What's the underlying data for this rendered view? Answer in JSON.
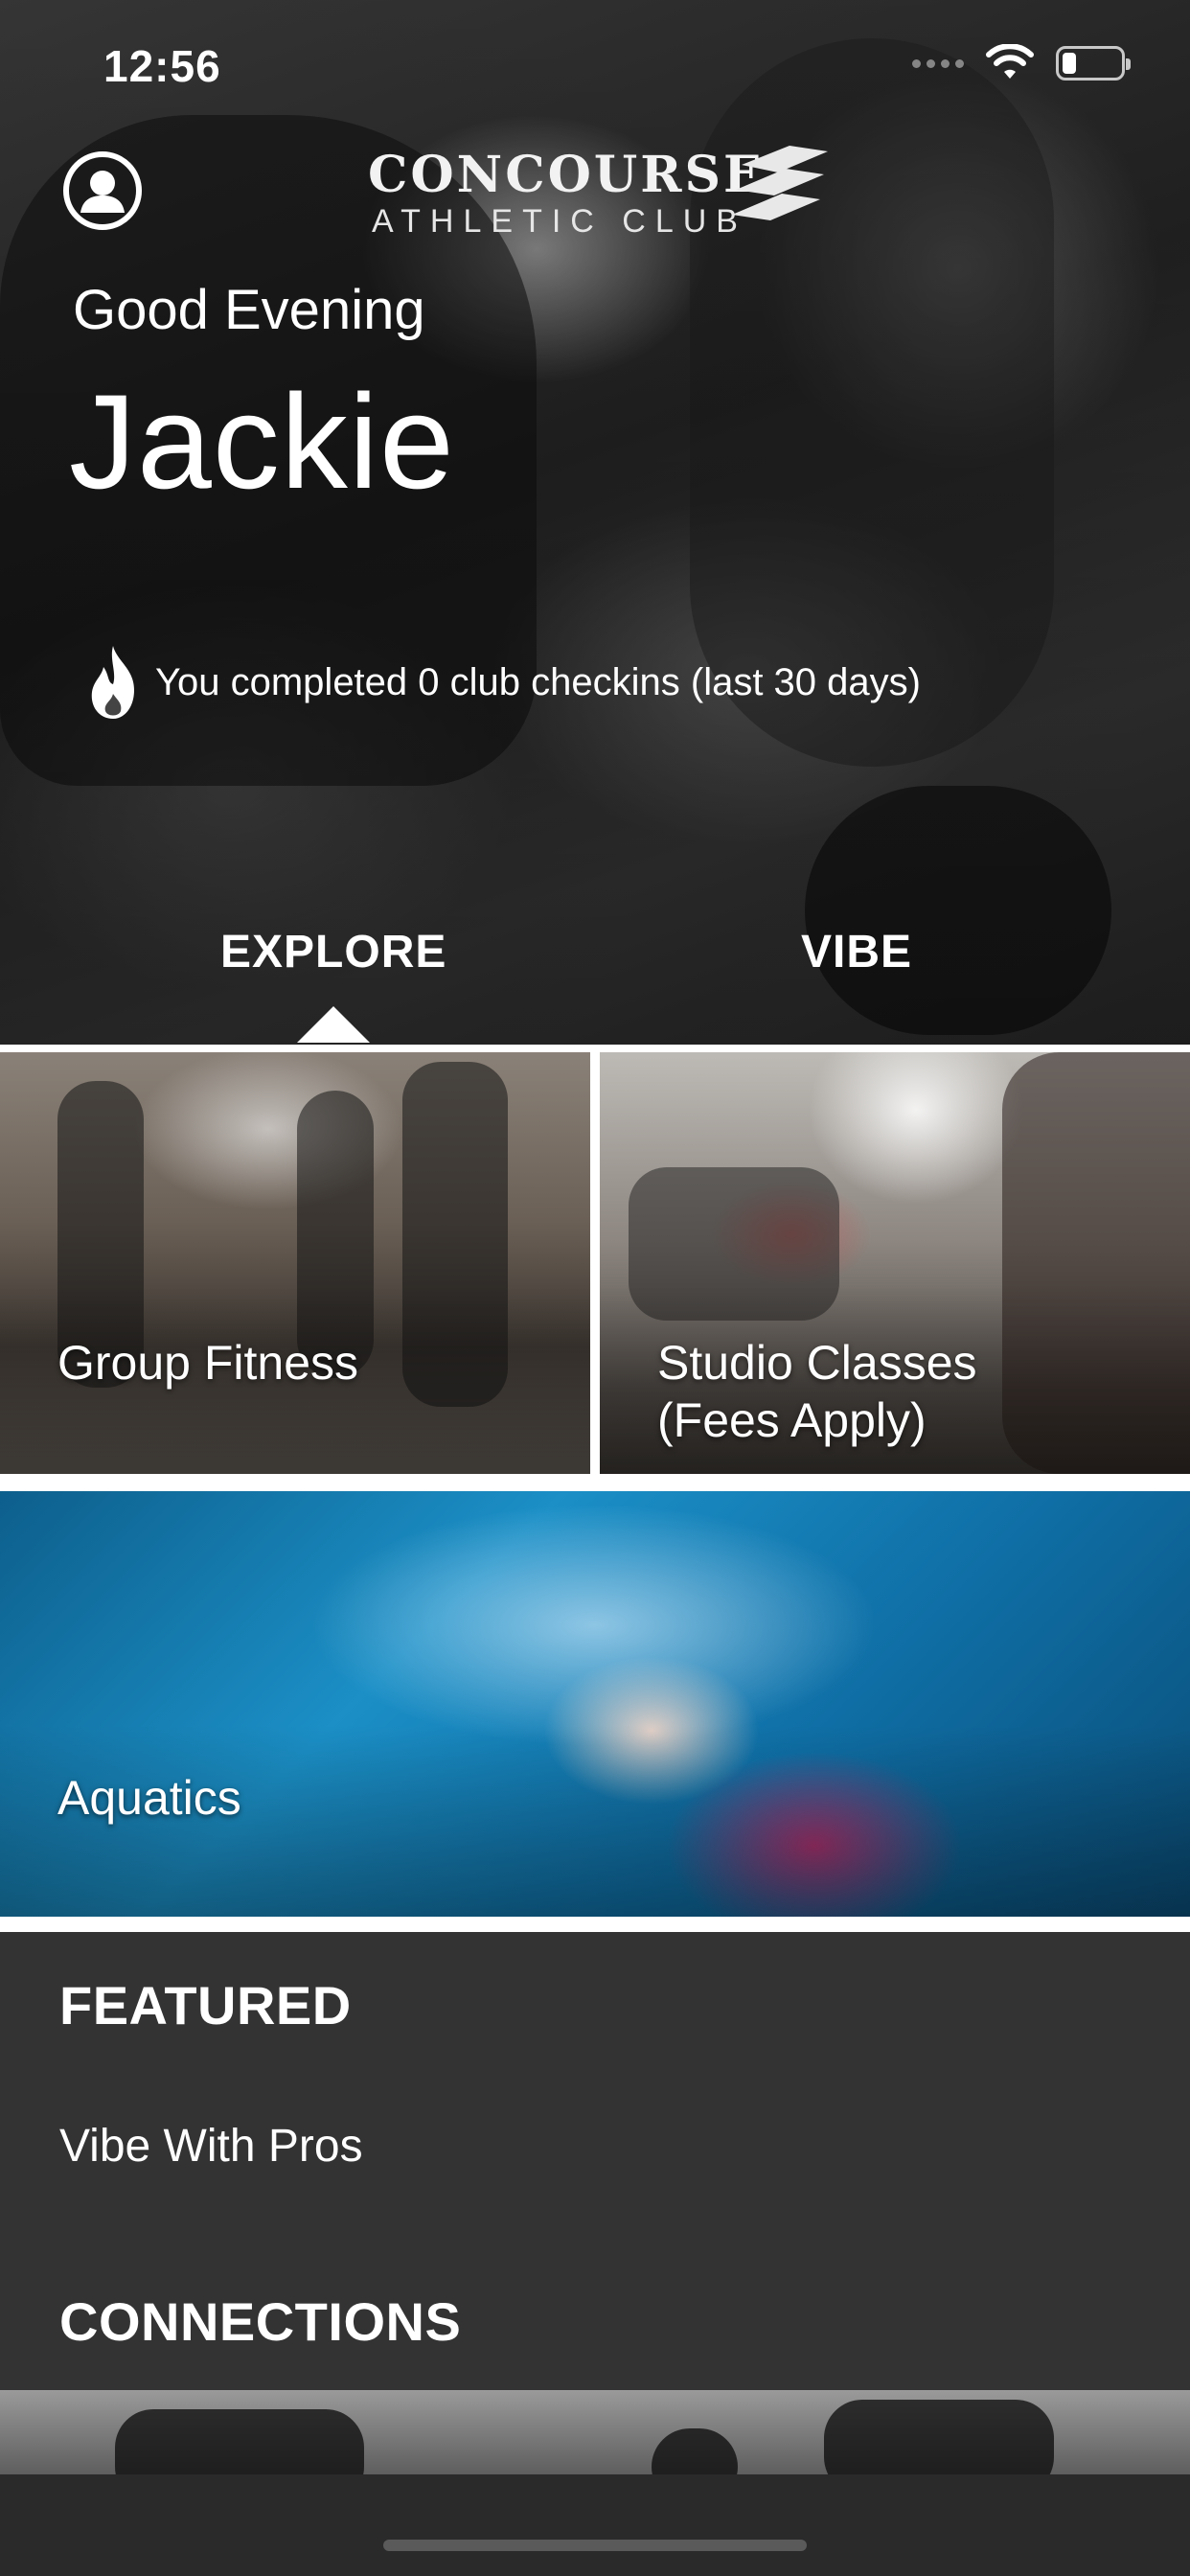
{
  "status_bar": {
    "time": "12:56",
    "signal_icon": "cellular-signal-icon",
    "wifi_icon": "wifi-icon",
    "battery_icon": "battery-icon",
    "battery_level": 0.15
  },
  "header": {
    "profile_icon": "user-profile-icon",
    "logo_main": "CONCOURSE",
    "logo_sub": "ATHLETIC CLUB",
    "greeting": "Good Evening",
    "name": "Jackie",
    "checkins_icon": "flame-icon",
    "checkins_text": "You completed 0 club checkins (last 30 days)"
  },
  "tabs": [
    {
      "label": "EXPLORE",
      "active": true
    },
    {
      "label": "VIBE",
      "active": false
    }
  ],
  "tiles": {
    "group_fitness": "Group Fitness",
    "studio_classes_line1": "Studio Classes",
    "studio_classes_line2": "(Fees Apply)",
    "aquatics": "Aquatics"
  },
  "featured": {
    "title": "FEATURED",
    "items": [
      "Vibe With Pros"
    ]
  },
  "connections": {
    "title": "CONNECTIONS"
  },
  "colors": {
    "background": "#333333",
    "text": "#ffffff",
    "tile_gap": "#ffffff"
  }
}
